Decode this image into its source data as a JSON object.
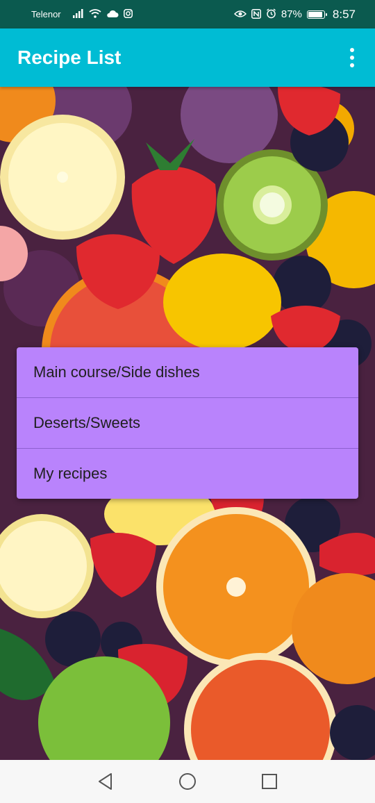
{
  "status_bar": {
    "carrier": "Telenor",
    "battery_percent": "87%",
    "time": "8:57",
    "battery_level": 0.87,
    "icons": [
      "signal-icon",
      "wifi-icon",
      "cloud-icon",
      "instagram-icon",
      "eye-icon",
      "nfc-icon",
      "alarm-icon",
      "battery-icon"
    ]
  },
  "app_bar": {
    "title": "Recipe List",
    "overflow_icon": "more-vert-icon"
  },
  "menu": {
    "items": [
      {
        "label": "Main course/Side dishes"
      },
      {
        "label": "Deserts/Sweets"
      },
      {
        "label": "My recipes"
      }
    ],
    "background_color": "#b983fc"
  },
  "nav_bar": {
    "icons": [
      "back-icon",
      "home-icon",
      "recents-icon"
    ]
  },
  "colors": {
    "status_bar": "#0b5a4f",
    "app_bar": "#00bcd4"
  }
}
